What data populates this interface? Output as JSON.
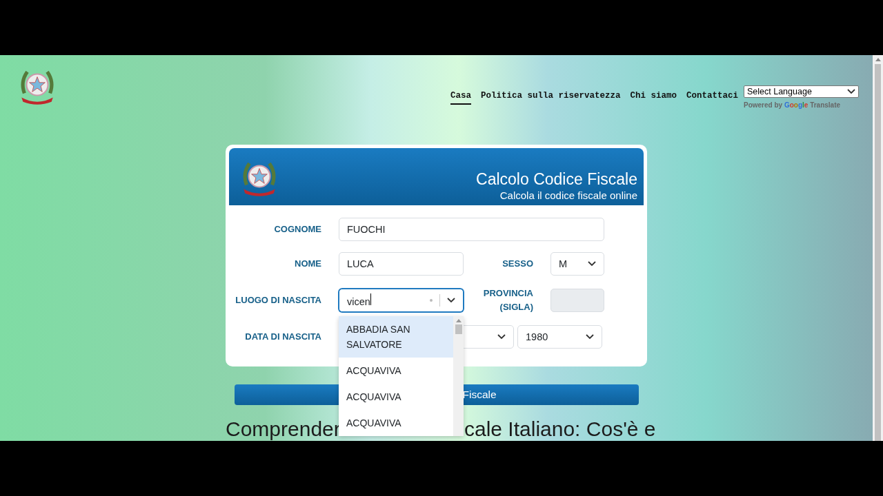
{
  "header": {
    "nav": [
      {
        "label": "Casa",
        "selected": true
      },
      {
        "label": "Politica sulla riservatezza",
        "selected": false
      },
      {
        "label": "Chi siamo",
        "selected": false
      },
      {
        "label": "Contattaci",
        "selected": false
      }
    ],
    "language_select": {
      "value": "Select Language"
    },
    "translate_credit": {
      "prefix": "Powered by",
      "brand": "Google",
      "suffix": "Translate"
    }
  },
  "card": {
    "title": "Calcolo Codice Fiscale",
    "subtitle": "Calcola il codice fiscale online",
    "cognome": {
      "label": "COGNOME",
      "value": "FUOCHI"
    },
    "nome": {
      "label": "NOME",
      "value": "LUCA"
    },
    "sesso": {
      "label": "SESSO",
      "value": "M"
    },
    "luogo": {
      "label": "LUOGO DI NASCITA",
      "value": "vicen",
      "focused": true
    },
    "provincia": {
      "label": "PROVINCIA (SIGLA)",
      "disabled": true
    },
    "data": {
      "label": "DATA DI NASCITA",
      "year": "1980"
    },
    "dropdown": [
      {
        "label": "ABBADIA SAN SALVATORE",
        "selected": true
      },
      {
        "label": "ACQUAVIVA",
        "selected": false
      },
      {
        "label": "ACQUAVIVA",
        "selected": false
      },
      {
        "label": "ACQUAVIVA",
        "selected": false
      }
    ]
  },
  "submit_button": {
    "visible_text": "Fiscale"
  },
  "heading": {
    "visible_parts": [
      "Comprender",
      "cale Italiano: Cos'è e"
    ]
  }
}
